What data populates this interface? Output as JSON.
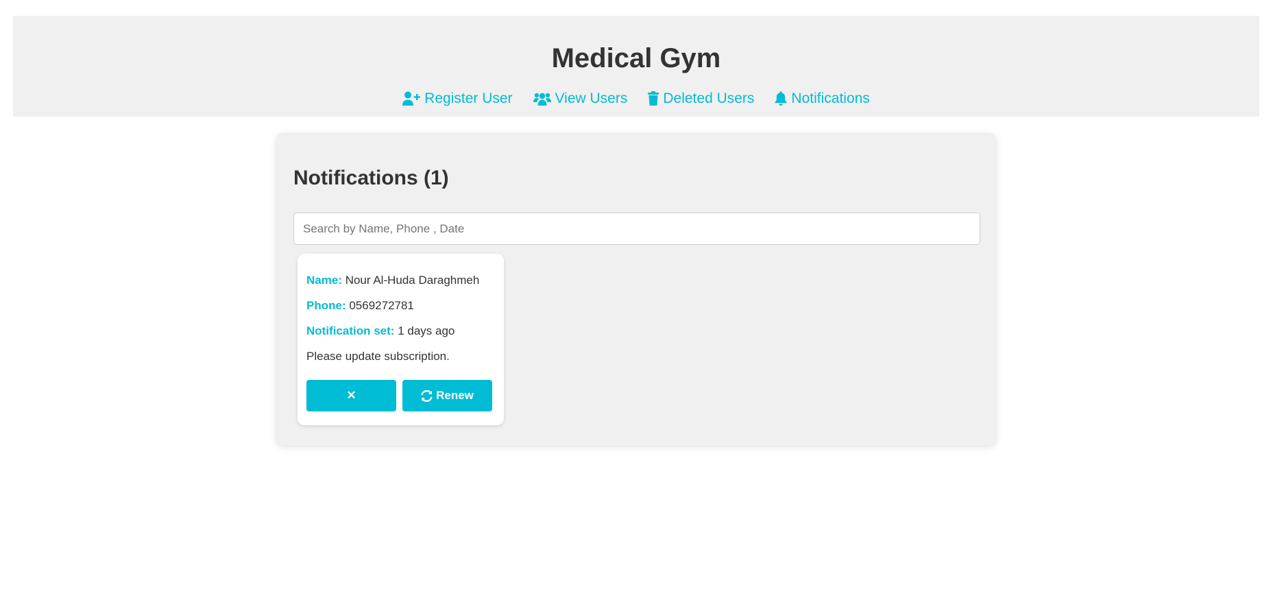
{
  "header": {
    "title": "Medical Gym",
    "nav": [
      {
        "label": "Register User",
        "icon": "user-plus-icon"
      },
      {
        "label": "View Users",
        "icon": "users-icon"
      },
      {
        "label": "Deleted Users",
        "icon": "trash-icon"
      },
      {
        "label": "Notifications",
        "icon": "bell-icon"
      }
    ]
  },
  "main": {
    "title": "Notifications (1)",
    "search": {
      "placeholder": "Search by Name, Phone , Date",
      "value": ""
    },
    "notifications": [
      {
        "name_label": "Name:",
        "name": "Nour Al-Huda Daraghmeh",
        "phone_label": "Phone:",
        "phone": "0569272781",
        "set_label": "Notification set:",
        "set": "1 days ago",
        "message": "Please update subscription.",
        "dismiss_label": "✕",
        "renew_label": "Renew"
      }
    ]
  },
  "colors": {
    "accent": "#00bcd4",
    "header_bg": "#f0f0f0",
    "text": "#333333"
  }
}
